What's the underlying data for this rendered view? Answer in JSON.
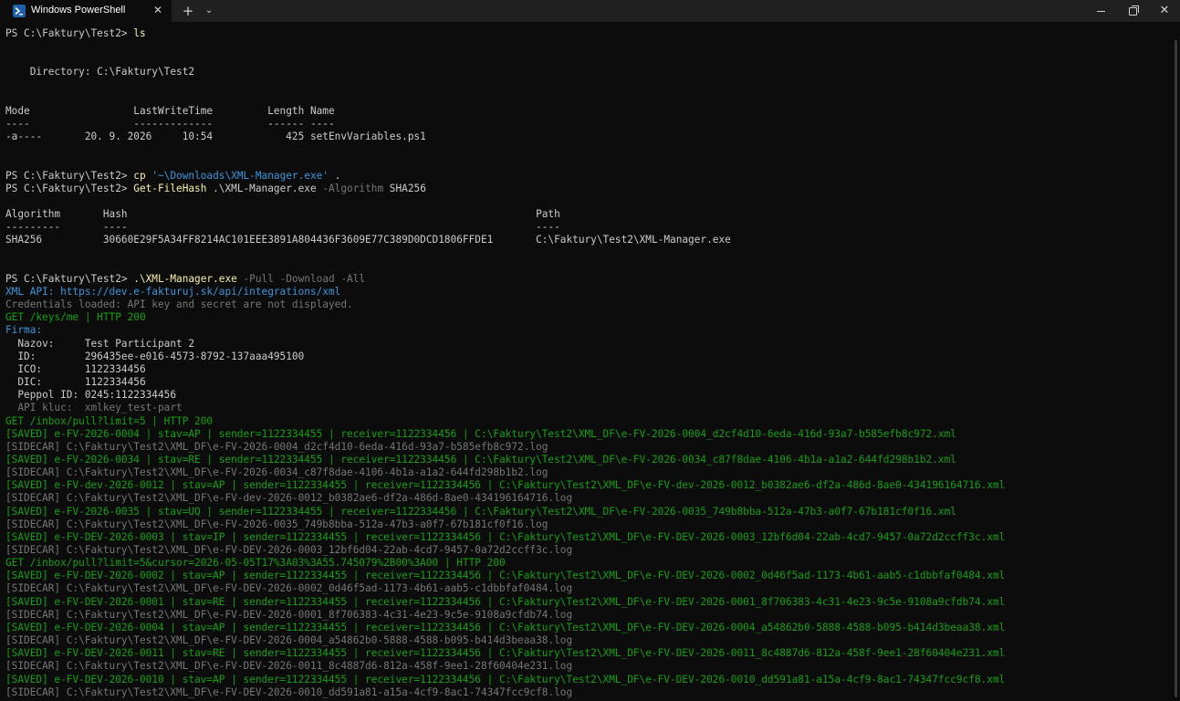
{
  "titlebar": {
    "tab_title": "Windows PowerShell",
    "close_tab_glyph": "✕",
    "new_tab_glyph": "+",
    "dropdown_glyph": "⌄",
    "close_window_glyph": "✕",
    "tab_icon": "powershell-icon"
  },
  "colors": {
    "background": "#0c0c0c",
    "default": "#cccccc",
    "command": "#f9f1a5",
    "parameter": "#767676",
    "string": "#3a96dd",
    "green": "#13a10e",
    "info": "#3a96dd",
    "gray": "#767676"
  },
  "terminal": {
    "lines": [
      {
        "t": 0,
        "segs": [
          {
            "c": "default",
            "text": "PS C:\\Faktury\\Test2> "
          },
          {
            "c": "command",
            "text": "ls"
          }
        ]
      },
      {
        "t": 2,
        "segs": [
          {
            "c": "default",
            "text": ""
          }
        ]
      },
      {
        "t": 3,
        "segs": [
          {
            "c": "default",
            "text": "    Directory: C:\\Faktury\\Test2"
          }
        ]
      },
      {
        "t": 6,
        "segs": [
          {
            "c": "default",
            "text": "Mode                 LastWriteTime         Length Name"
          }
        ]
      },
      {
        "t": 7,
        "segs": [
          {
            "c": "default",
            "text": "----                 -------------         ------ ----"
          }
        ]
      },
      {
        "t": 8,
        "segs": [
          {
            "c": "default",
            "text": "-a----       20. 9. 2026     10:54            425 setEnvVariables.ps1"
          }
        ]
      },
      {
        "t": 11,
        "segs": [
          {
            "c": "default",
            "text": "PS C:\\Faktury\\Test2> "
          },
          {
            "c": "command",
            "text": "cp "
          },
          {
            "c": "string",
            "text": "'~\\Downloads\\XML-Manager.exe'"
          },
          {
            "c": "default",
            "text": " ."
          }
        ]
      },
      {
        "t": 12,
        "segs": [
          {
            "c": "default",
            "text": "PS C:\\Faktury\\Test2> "
          },
          {
            "c": "command",
            "text": "Get-FileHash"
          },
          {
            "c": "default",
            "text": " .\\XML-Manager.exe "
          },
          {
            "c": "parameter",
            "text": "-Algorithm"
          },
          {
            "c": "default",
            "text": " SHA256"
          }
        ]
      },
      {
        "t": 14,
        "segs": [
          {
            "c": "default",
            "text": "Algorithm       Hash                                                                   Path"
          }
        ]
      },
      {
        "t": 15,
        "segs": [
          {
            "c": "default",
            "text": "---------       ----                                                                   ----"
          }
        ]
      },
      {
        "t": 16,
        "segs": [
          {
            "c": "default",
            "text": "SHA256          30660E29F5A34FF8214AC101EEE3891A804436F3609E77C389D0DCD1806FFDE1       C:\\Faktury\\Test2\\XML-Manager.exe"
          }
        ]
      },
      {
        "t": 19,
        "segs": [
          {
            "c": "default",
            "text": "PS C:\\Faktury\\Test2> "
          },
          {
            "c": "command",
            "text": ".\\XML-Manager.exe"
          },
          {
            "c": "parameter",
            "text": " -Pull -Download -All"
          }
        ]
      },
      {
        "t": 20,
        "segs": [
          {
            "c": "info",
            "text": "XML API: https://dev.e-fakturuj.sk/api/integrations/xml"
          }
        ]
      },
      {
        "t": 21,
        "segs": [
          {
            "c": "gray",
            "text": "Credentials loaded: API key and secret are not displayed."
          }
        ]
      },
      {
        "t": 22,
        "segs": [
          {
            "c": "green",
            "text": "GET /keys/me | HTTP 200"
          }
        ]
      },
      {
        "t": 23,
        "segs": [
          {
            "c": "info",
            "text": "Firma:"
          }
        ]
      },
      {
        "t": 24,
        "segs": [
          {
            "c": "default",
            "text": "  Nazov:     Test Participant 2"
          }
        ]
      },
      {
        "t": 25,
        "segs": [
          {
            "c": "default",
            "text": "  ID:        296435ee-e016-4573-8792-137aaa495100"
          }
        ]
      },
      {
        "t": 26,
        "segs": [
          {
            "c": "default",
            "text": "  ICO:       1122334456"
          }
        ]
      },
      {
        "t": 27,
        "segs": [
          {
            "c": "default",
            "text": "  DIC:       1122334456"
          }
        ]
      },
      {
        "t": 28,
        "segs": [
          {
            "c": "default",
            "text": "  Peppol ID: 0245:1122334456"
          }
        ]
      },
      {
        "t": 29,
        "segs": [
          {
            "c": "gray",
            "text": "  API kluc:  xmlkey_test-part"
          }
        ]
      },
      {
        "t": 30,
        "segs": [
          {
            "c": "green",
            "text": "GET /inbox/pull?limit=5 | HTTP 200"
          }
        ]
      },
      {
        "t": 31,
        "segs": [
          {
            "c": "green",
            "text": "[SAVED] e-FV-2026-0004 | stav=AP | sender=1122334455 | receiver=1122334456 | C:\\Faktury\\Test2\\XML_DF\\e-FV-2026-0004_d2cf4d10-6eda-416d-93a7-b585efb8c972.xml"
          }
        ]
      },
      {
        "t": 32,
        "segs": [
          {
            "c": "gray",
            "text": "[SIDECAR] C:\\Faktury\\Test2\\XML_DF\\e-FV-2026-0004_d2cf4d10-6eda-416d-93a7-b585efb8c972.log"
          }
        ]
      },
      {
        "t": 33,
        "segs": [
          {
            "c": "green",
            "text": "[SAVED] e-FV-2026-0034 | stav=RE | sender=1122334455 | receiver=1122334456 | C:\\Faktury\\Test2\\XML_DF\\e-FV-2026-0034_c87f8dae-4106-4b1a-a1a2-644fd298b1b2.xml"
          }
        ]
      },
      {
        "t": 34,
        "segs": [
          {
            "c": "gray",
            "text": "[SIDECAR] C:\\Faktury\\Test2\\XML_DF\\e-FV-2026-0034_c87f8dae-4106-4b1a-a1a2-644fd298b1b2.log"
          }
        ]
      },
      {
        "t": 35,
        "segs": [
          {
            "c": "green",
            "text": "[SAVED] e-FV-dev-2026-0012 | stav=AP | sender=1122334455 | receiver=1122334456 | C:\\Faktury\\Test2\\XML_DF\\e-FV-dev-2026-0012_b0382ae6-df2a-486d-8ae0-434196164716.xml"
          }
        ]
      },
      {
        "t": 36,
        "segs": [
          {
            "c": "gray",
            "text": "[SIDECAR] C:\\Faktury\\Test2\\XML_DF\\e-FV-dev-2026-0012_b0382ae6-df2a-486d-8ae0-434196164716.log"
          }
        ]
      },
      {
        "t": 37,
        "segs": [
          {
            "c": "green",
            "text": "[SAVED] e-FV-2026-0035 | stav=UQ | sender=1122334455 | receiver=1122334456 | C:\\Faktury\\Test2\\XML_DF\\e-FV-2026-0035_749b8bba-512a-47b3-a0f7-67b181cf0f16.xml"
          }
        ]
      },
      {
        "t": 38,
        "segs": [
          {
            "c": "gray",
            "text": "[SIDECAR] C:\\Faktury\\Test2\\XML_DF\\e-FV-2026-0035_749b8bba-512a-47b3-a0f7-67b181cf0f16.log"
          }
        ]
      },
      {
        "t": 39,
        "segs": [
          {
            "c": "green",
            "text": "[SAVED] e-FV-DEV-2026-0003 | stav=IP | sender=1122334455 | receiver=1122334456 | C:\\Faktury\\Test2\\XML_DF\\e-FV-DEV-2026-0003_12bf6d04-22ab-4cd7-9457-0a72d2ccff3c.xml"
          }
        ]
      },
      {
        "t": 40,
        "segs": [
          {
            "c": "gray",
            "text": "[SIDECAR] C:\\Faktury\\Test2\\XML_DF\\e-FV-DEV-2026-0003_12bf6d04-22ab-4cd7-9457-0a72d2ccff3c.log"
          }
        ]
      },
      {
        "t": 41,
        "segs": [
          {
            "c": "green",
            "text": "GET /inbox/pull?limit=5&cursor=2026-05-05T17%3A03%3A55.745079%2B00%3A00 | HTTP 200"
          }
        ]
      },
      {
        "t": 42,
        "segs": [
          {
            "c": "green",
            "text": "[SAVED] e-FV-DEV-2026-0002 | stav=AP | sender=1122334455 | receiver=1122334456 | C:\\Faktury\\Test2\\XML_DF\\e-FV-DEV-2026-0002_0d46f5ad-1173-4b61-aab5-c1dbbfaf0484.xml"
          }
        ]
      },
      {
        "t": 43,
        "segs": [
          {
            "c": "gray",
            "text": "[SIDECAR] C:\\Faktury\\Test2\\XML_DF\\e-FV-DEV-2026-0002_0d46f5ad-1173-4b61-aab5-c1dbbfaf0484.log"
          }
        ]
      },
      {
        "t": 44,
        "segs": [
          {
            "c": "green",
            "text": "[SAVED] e-FV-DEV-2026-0001 | stav=RE | sender=1122334455 | receiver=1122334456 | C:\\Faktury\\Test2\\XML_DF\\e-FV-DEV-2026-0001_8f706383-4c31-4e23-9c5e-9108a9cfdb74.xml"
          }
        ]
      },
      {
        "t": 45,
        "segs": [
          {
            "c": "gray",
            "text": "[SIDECAR] C:\\Faktury\\Test2\\XML_DF\\e-FV-DEV-2026-0001_8f706383-4c31-4e23-9c5e-9108a9cfdb74.log"
          }
        ]
      },
      {
        "t": 46,
        "segs": [
          {
            "c": "green",
            "text": "[SAVED] e-FV-DEV-2026-0004 | stav=AP | sender=1122334455 | receiver=1122334456 | C:\\Faktury\\Test2\\XML_DF\\e-FV-DEV-2026-0004_a54862b0-5888-4588-b095-b414d3beaa38.xml"
          }
        ]
      },
      {
        "t": 47,
        "segs": [
          {
            "c": "gray",
            "text": "[SIDECAR] C:\\Faktury\\Test2\\XML_DF\\e-FV-DEV-2026-0004_a54862b0-5888-4588-b095-b414d3beaa38.log"
          }
        ]
      },
      {
        "t": 48,
        "segs": [
          {
            "c": "green",
            "text": "[SAVED] e-FV-DEV-2026-0011 | stav=RE | sender=1122334455 | receiver=1122334456 | C:\\Faktury\\Test2\\XML_DF\\e-FV-DEV-2026-0011_8c4887d6-812a-458f-9ee1-28f60404e231.xml"
          }
        ]
      },
      {
        "t": 49,
        "segs": [
          {
            "c": "gray",
            "text": "[SIDECAR] C:\\Faktury\\Test2\\XML_DF\\e-FV-DEV-2026-0011_8c4887d6-812a-458f-9ee1-28f60404e231.log"
          }
        ]
      },
      {
        "t": 50,
        "segs": [
          {
            "c": "green",
            "text": "[SAVED] e-FV-DEV-2026-0010 | stav=AP | sender=1122334455 | receiver=1122334456 | C:\\Faktury\\Test2\\XML_DF\\e-FV-DEV-2026-0010_dd591a81-a15a-4cf9-8ac1-74347fcc9cf8.xml"
          }
        ]
      },
      {
        "t": 51,
        "segs": [
          {
            "c": "gray",
            "text": "[SIDECAR] C:\\Faktury\\Test2\\XML_DF\\e-FV-DEV-2026-0010_dd591a81-a15a-4cf9-8ac1-74347fcc9cf8.log"
          }
        ]
      }
    ]
  }
}
